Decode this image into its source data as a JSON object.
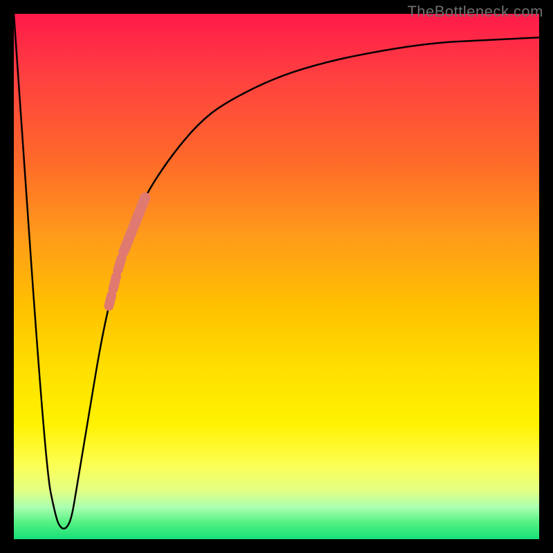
{
  "attribution": "TheBottleneck.com",
  "chart_data": {
    "type": "line",
    "title": "",
    "xlabel": "",
    "ylabel": "",
    "xlim": [
      0,
      100
    ],
    "ylim": [
      0,
      100
    ],
    "series": [
      {
        "name": "bottleneck-curve",
        "x": [
          0,
          6,
          8,
          9,
          10,
          11,
          12,
          14,
          17,
          20,
          22,
          24,
          26,
          30,
          35,
          40,
          50,
          60,
          70,
          80,
          90,
          100
        ],
        "y": [
          100,
          14,
          4,
          2,
          2,
          4,
          10,
          22,
          40,
          52,
          58,
          63,
          67,
          73,
          79,
          83,
          88,
          91,
          93,
          94.5,
          95,
          95.5
        ]
      }
    ],
    "markers": [
      {
        "name": "marker-dot-d",
        "x_range": [
          18.1,
          18.6
        ],
        "y_range_on_curve": true,
        "color": "#e07a70",
        "width": 14
      },
      {
        "name": "marker-dot-c",
        "x_range": [
          18.9,
          19.5
        ],
        "y_range_on_curve": true,
        "color": "#e07a70",
        "width": 14
      },
      {
        "name": "marker-dot-b",
        "x_range": [
          19.8,
          20.5
        ],
        "y_range_on_curve": true,
        "color": "#e07a70",
        "width": 14
      },
      {
        "name": "marker-segment",
        "x_range": [
          20.9,
          25.0
        ],
        "y_range_on_curve": true,
        "color": "#e07a70",
        "width": 15
      }
    ],
    "background_gradient": {
      "top": "#ff1a4a",
      "mid_upper": "#ff9a1a",
      "mid": "#ffe000",
      "mid_lower": "#fcff55",
      "bottom": "#18e07a"
    },
    "frame_color": "#000000"
  }
}
